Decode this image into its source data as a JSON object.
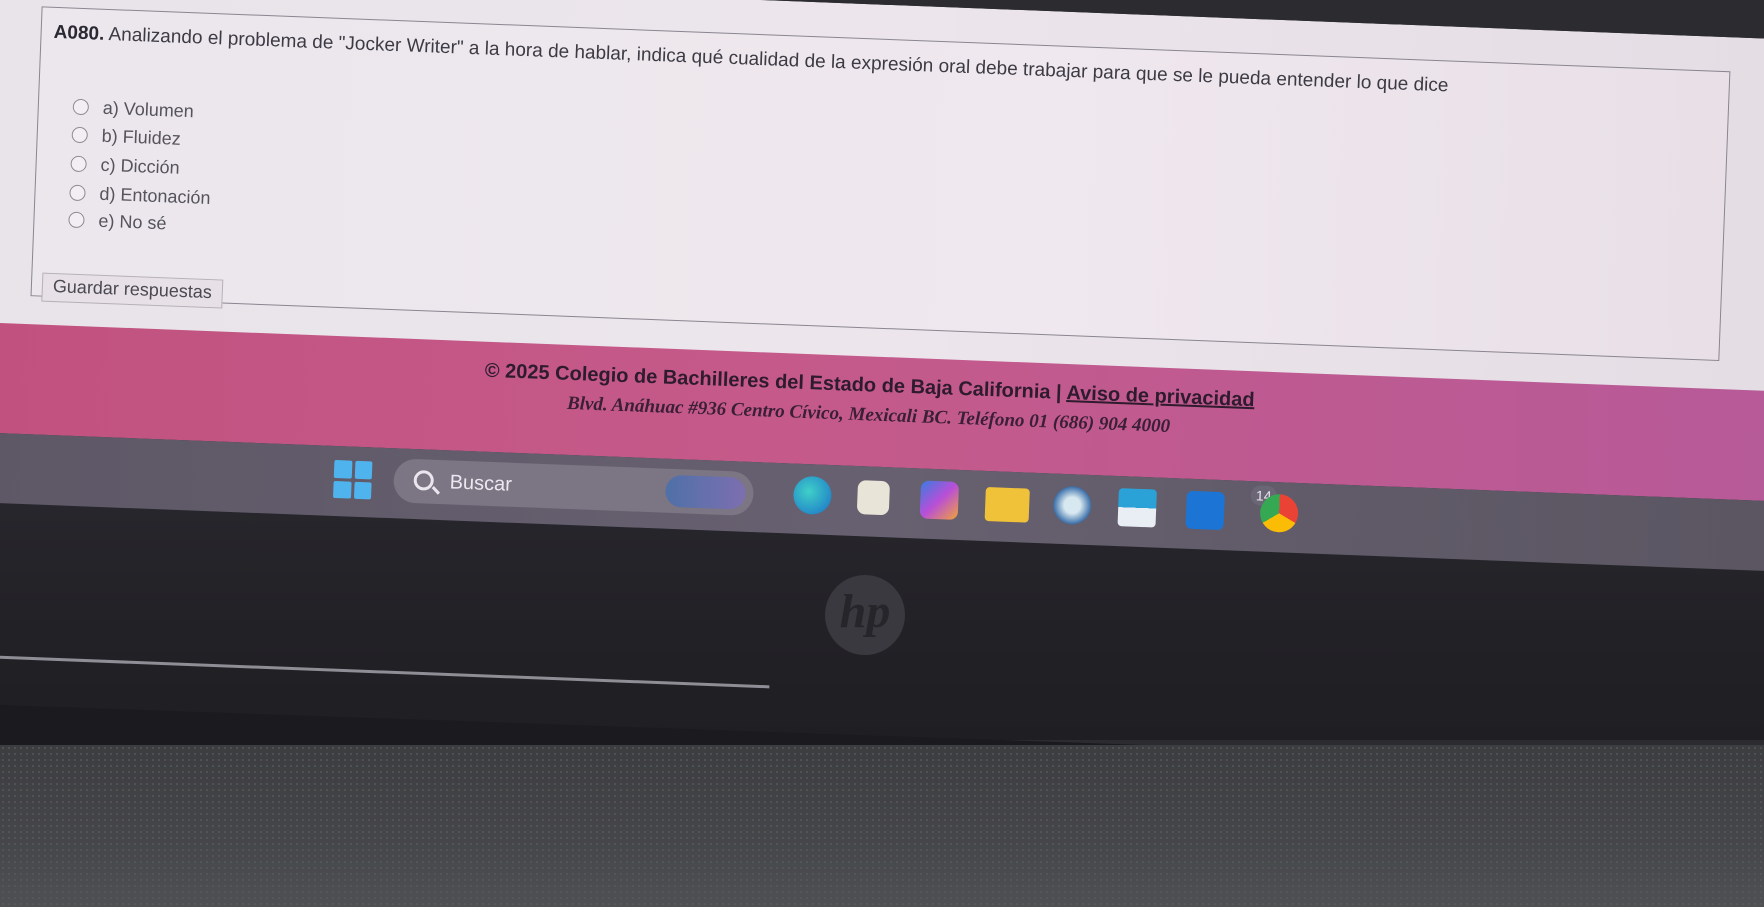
{
  "quiz": {
    "question_id": "A080.",
    "question_text": " Analizando el problema de \"Jocker Writer\" a la hora de hablar, indica qué cualidad de la expresión oral debe trabajar para que se le pueda entender lo que dice",
    "options": [
      {
        "label": "a) Volumen"
      },
      {
        "label": "b) Fluidez"
      },
      {
        "label": "c) Dicción"
      },
      {
        "label": "d) Entonación"
      },
      {
        "label": "e) No sé"
      }
    ],
    "save_button": "Guardar respuestas"
  },
  "footer": {
    "copyright": "© 2025 Colegio de Bachilleres del Estado de Baja California | ",
    "privacy_link": "Aviso de privacidad",
    "address": "Blvd. Anáhuac #936 Centro Cívico, Mexicali BC. Teléfono 01 (686) 904 4000"
  },
  "taskbar": {
    "search_placeholder": "Buscar",
    "badge_count": "14"
  },
  "bezel": {
    "brand": "hp"
  }
}
